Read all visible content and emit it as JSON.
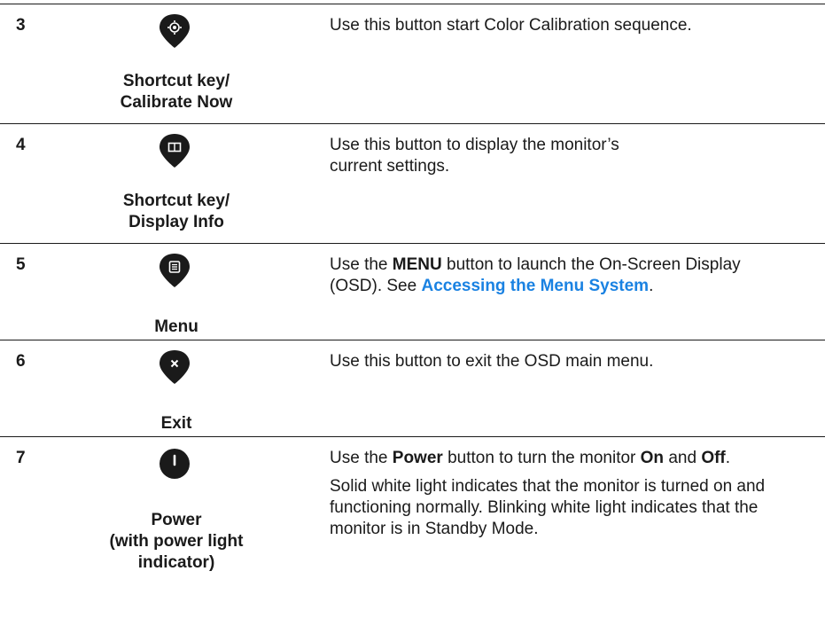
{
  "rows": [
    {
      "number": "3",
      "icon": "calibrate-icon",
      "label_line1": "Shortcut key/",
      "label_line2": "Calibrate Now",
      "desc": "Use this button start Color Calibration sequence."
    },
    {
      "number": "4",
      "icon": "display-info-icon",
      "label_line1": "Shortcut key/",
      "label_line2": "Display Info",
      "desc": "Use this button to display the monitor’s current settings."
    },
    {
      "number": "5",
      "icon": "menu-icon",
      "label_line1": "Menu",
      "desc_part1": "Use the ",
      "desc_bold1": "MENU",
      "desc_part2": " button to launch the On-Screen Display (OSD). See ",
      "desc_link": "Accessing the Menu System",
      "desc_part3": "."
    },
    {
      "number": "6",
      "icon": "exit-icon",
      "label_line1": "Exit",
      "desc": "Use this button to exit the OSD main menu."
    },
    {
      "number": "7",
      "icon": "power-icon",
      "label_line1": "Power",
      "label_line2": "(with power light",
      "label_line3": "indicator)",
      "desc_part1": "Use the ",
      "desc_bold1": "Power",
      "desc_part2": " button to turn the monitor ",
      "desc_bold2": "On",
      "desc_part3": " and ",
      "desc_bold3": "Off",
      "desc_part4": ".",
      "desc_para2": "Solid white light indicates that the monitor is turned on and functioning normally. Blinking white light indicates that the monitor is in Standby Mode."
    }
  ],
  "colors": {
    "text": "#1a1a1a",
    "link": "#1a82e2",
    "icon_bg": "#1a1a1a",
    "icon_fg": "#ffffff"
  }
}
